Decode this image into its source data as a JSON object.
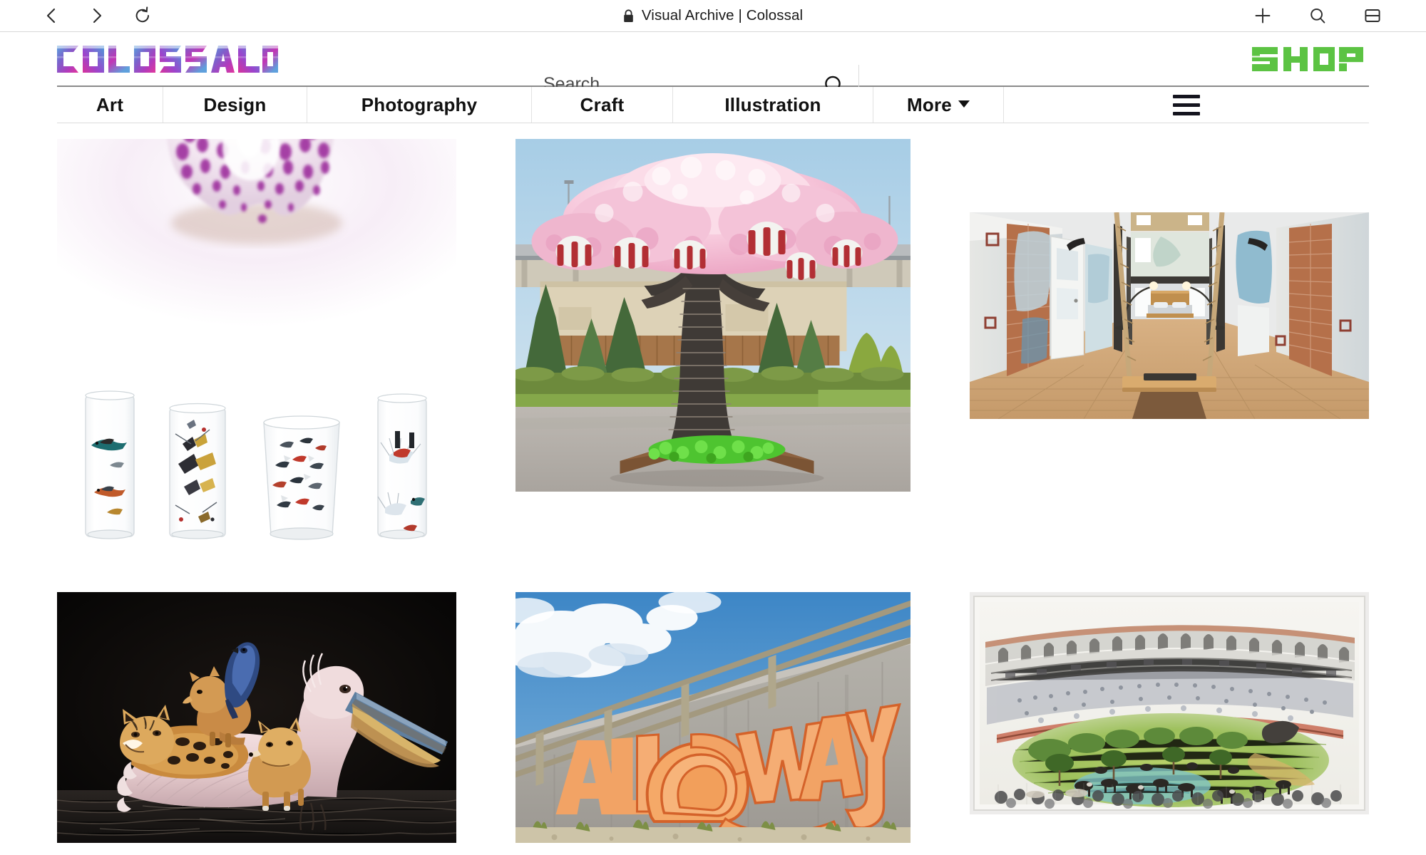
{
  "browser": {
    "back_icon": "chevron-left-icon",
    "forward_icon": "chevron-right-icon",
    "reload_icon": "reload-icon",
    "lock_icon": "lock-icon",
    "title": "Visual Archive | Colossal",
    "new_tab_icon": "plus-icon",
    "search_icon": "search-icon",
    "sidebar_icon": "tab-overview-icon"
  },
  "header": {
    "logo_text": "COLOSSAL",
    "logo_colors": [
      "#4f9cd8",
      "#7b5bc4",
      "#b240c0",
      "#d6359a",
      "#8e4fd0"
    ],
    "search": {
      "placeholder": "Search",
      "value": "",
      "submit_icon": "search-icon"
    },
    "shop_text": "SHOP",
    "shop_color": "#5cc343"
  },
  "nav": {
    "items": [
      {
        "label": "Art",
        "icon": "",
        "has_dropdown": false
      },
      {
        "label": "Design",
        "icon": "",
        "has_dropdown": false
      },
      {
        "label": "Photography",
        "icon": "",
        "has_dropdown": false
      },
      {
        "label": "Craft",
        "icon": "",
        "has_dropdown": false
      },
      {
        "label": "Illustration",
        "icon": "",
        "has_dropdown": false
      },
      {
        "label": "More",
        "icon": "chevron-down-icon",
        "has_dropdown": true
      }
    ],
    "menu_icon": "hamburger-menu-icon"
  },
  "grid": {
    "items": [
      {
        "id": "coral",
        "name": "purple-spotted-shell-image",
        "alt": "Close-up of a white seashell with purple spots, partially cropped at top",
        "column": 1,
        "row": 1
      },
      {
        "id": "glassware",
        "name": "bird-patterned-glassware-image",
        "alt": "Four clear drinking glasses decorated with illustrated birds, butterflies and feathers",
        "column": 1,
        "row": 1
      },
      {
        "id": "lego-tree",
        "name": "lego-cherry-blossom-tree-image",
        "alt": "Large pink cherry blossom tree sculpture built from toy bricks in an outdoor planter",
        "column": 2,
        "row": 1
      },
      {
        "id": "loft-swing",
        "name": "loft-interior-swing-image",
        "alt": "Renovated loft interior with exposed brick, wood floors and a rope swing in front of a bed",
        "column": 3,
        "row": 1
      },
      {
        "id": "pelican",
        "name": "pelican-with-animals-painting",
        "alt": "Painting of a pink pelican on dark water carrying an ocelot, foxes and a blue bird on its back",
        "column": 1,
        "row": 2
      },
      {
        "id": "all-the-way-mural",
        "name": "all-the-way-mural-image",
        "alt": "Orange typographic mural reading ALL THE WAY painted on a concrete retaining wall under a fence",
        "mural_text": "ALL THE WAY",
        "column": 2,
        "row": 2
      },
      {
        "id": "arena-drawing",
        "name": "bullring-landscape-drawing",
        "alt": "Framed colored-pencil drawing of a bullring arena overgrown with green pasture, trees and grazing bulls",
        "column": 3,
        "row": 2
      }
    ]
  }
}
